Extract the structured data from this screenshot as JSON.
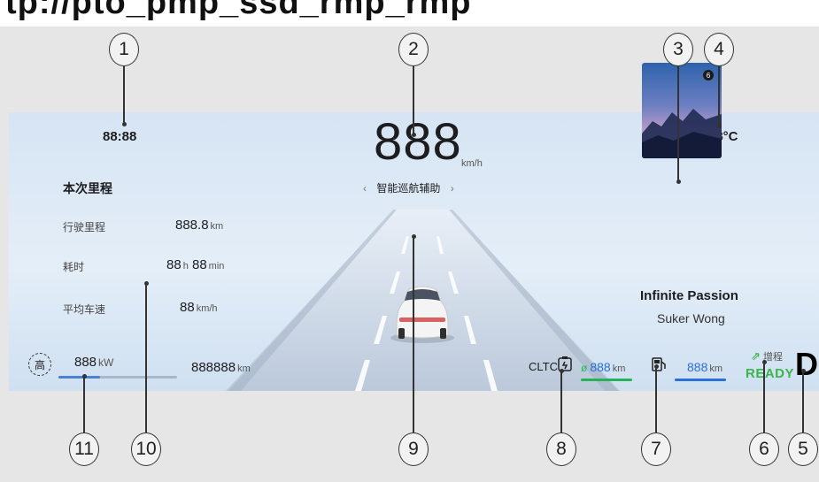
{
  "header": {
    "cut_text": "tp://pto_pmp_ssd_rmp_rmp"
  },
  "clock": "88:88",
  "speed": {
    "value": "888",
    "unit": "km/h",
    "mode": "智能巡航辅助",
    "prev": "‹",
    "next": "›"
  },
  "temperature": "-88°C",
  "trip": {
    "title": "本次里程",
    "rows": [
      {
        "label": "行驶里程",
        "value": "888.8",
        "unit": "km"
      },
      {
        "label": "耗时",
        "value_h": "88",
        "unit_h": "h",
        "value_m": "88",
        "unit_m": "min"
      },
      {
        "label": "平均车速",
        "value": "88",
        "unit": "km/h"
      }
    ]
  },
  "power": {
    "badge": "高",
    "value": "888",
    "unit": "kW",
    "level": 0.35
  },
  "odometer": {
    "value": "888888",
    "unit": "km"
  },
  "range": {
    "standard": "CLTC",
    "electric_value": "888",
    "electric_unit": "km",
    "electric_prefix": "ø",
    "fuel_value": "888",
    "fuel_unit": "km"
  },
  "media": {
    "title": "Infinite Passion",
    "artist": "Suker Wong"
  },
  "status": {
    "mode": "增程",
    "ready": "READY",
    "gear": "D"
  },
  "callouts": [
    "1",
    "2",
    "3",
    "4",
    "5",
    "6",
    "7",
    "8",
    "9",
    "10",
    "11"
  ],
  "colors": {
    "accent_blue": "#2a6fd6",
    "electric_green": "#27b25a",
    "ready_green": "#39b54a"
  },
  "icons": {
    "power": "power-gauge-icon",
    "battery": "battery-plug-icon",
    "fuel": "fuel-pump-icon",
    "extended": "extended-range-icon"
  }
}
